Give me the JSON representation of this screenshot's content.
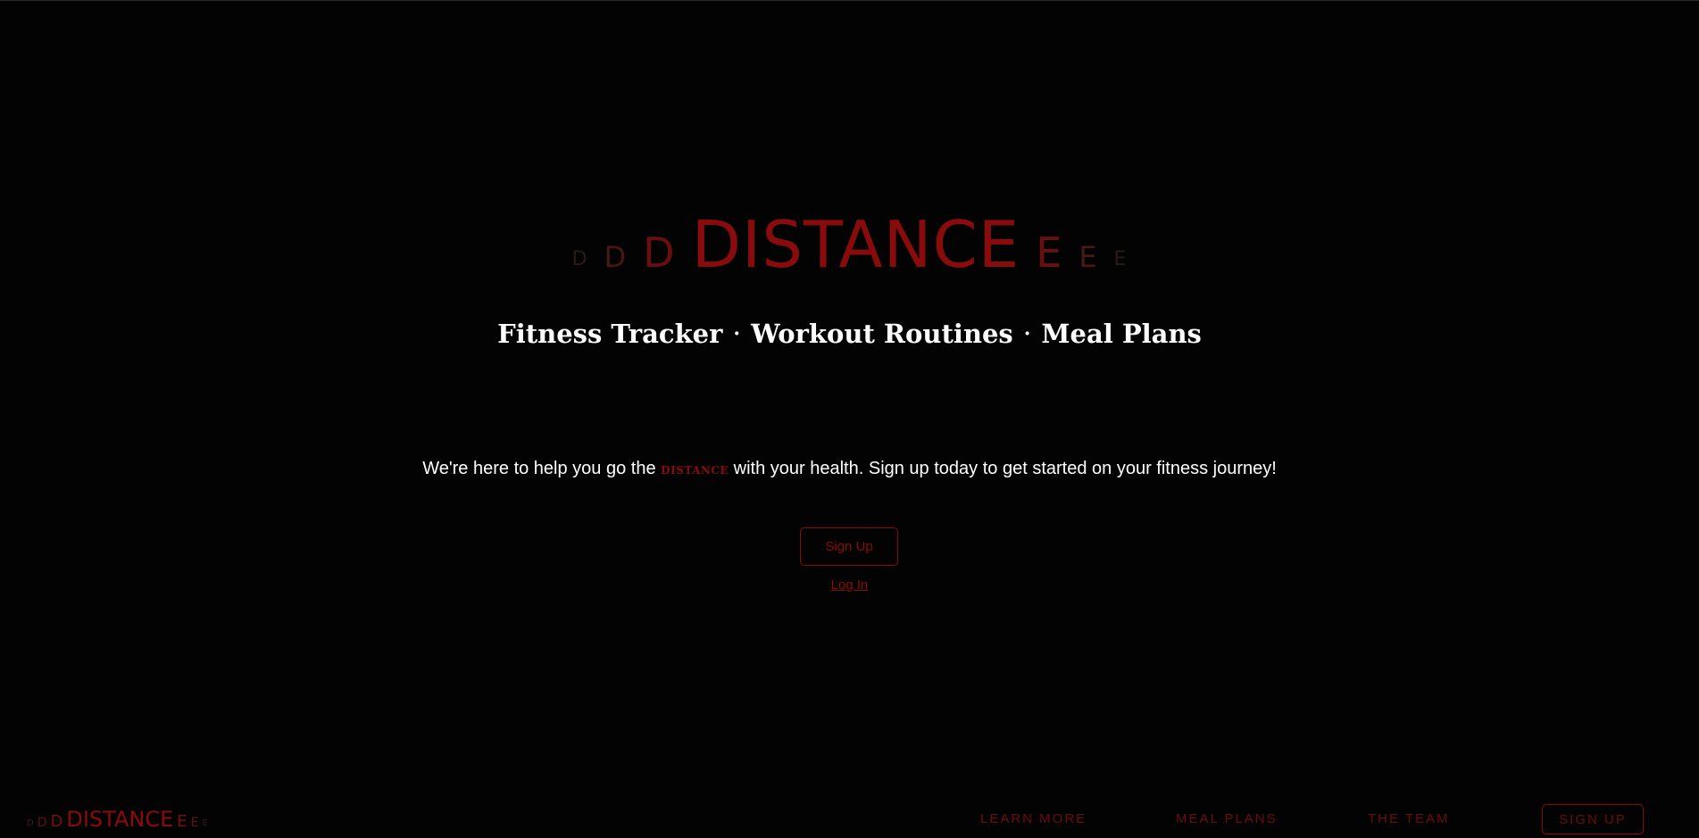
{
  "hero": {
    "logo": {
      "left_letters": [
        "D",
        "D",
        "D"
      ],
      "main": "DISTANCE",
      "right_letters": [
        "E",
        "E",
        "E"
      ]
    },
    "tagline": {
      "items": [
        "Fitness Tracker",
        "Workout Routines",
        "Meal Plans"
      ],
      "separator": "·"
    },
    "intro": {
      "before": "We're here to help you go the",
      "brand_word": "DISTANCE",
      "after": "with your health. Sign up today to get started on your fitness journey!"
    },
    "signup_label": "Sign Up",
    "login_label": "Log In"
  },
  "footer": {
    "logo": {
      "left_letters": [
        "D",
        "D",
        "D"
      ],
      "main": "DISTANCE",
      "right_letters": [
        "E",
        "E",
        "E"
      ]
    },
    "nav": {
      "learn_more": "LEARN MORE",
      "meal_plans": "MEAL PLANS",
      "the_team": "THE TEAM",
      "sign_up": "SIGN UP"
    }
  },
  "colors": {
    "background": "#030303",
    "accent": "#8a0b0b",
    "text": "#ffffff"
  }
}
